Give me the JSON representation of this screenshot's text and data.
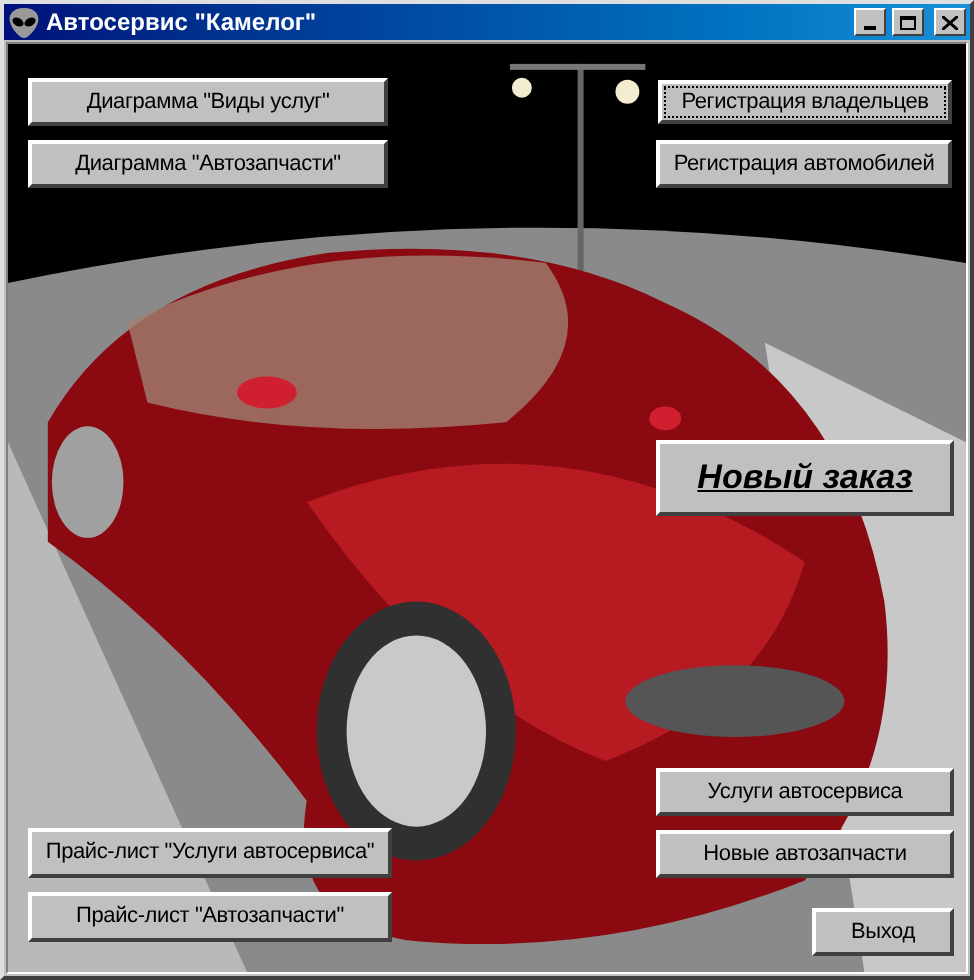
{
  "window": {
    "title": "Автосервис \"Камелог\""
  },
  "buttons": [
    {
      "label": "Диаграмма \"Виды услуг\"",
      "kind": "normal",
      "focused": false
    },
    {
      "label": "Диаграмма \"Автозапчасти\"",
      "kind": "normal",
      "focused": false
    },
    {
      "label": "Регистрация владельцев",
      "kind": "normal",
      "focused": true
    },
    {
      "label": "Регистрация автомобилей",
      "kind": "normal",
      "focused": false
    },
    {
      "label": "Новый заказ",
      "kind": "large",
      "focused": false
    },
    {
      "label": "Услуги автосервиса",
      "kind": "normal",
      "focused": false
    },
    {
      "label": "Прайс-лист \"Услуги автосервиса\"",
      "kind": "normal",
      "focused": false
    },
    {
      "label": "Новые автозапчасти",
      "kind": "normal",
      "focused": false
    },
    {
      "label": "Прайс-лист \"Автозапчасти\"",
      "kind": "normal",
      "focused": false
    },
    {
      "label": "Выход",
      "kind": "normal",
      "focused": false
    }
  ]
}
